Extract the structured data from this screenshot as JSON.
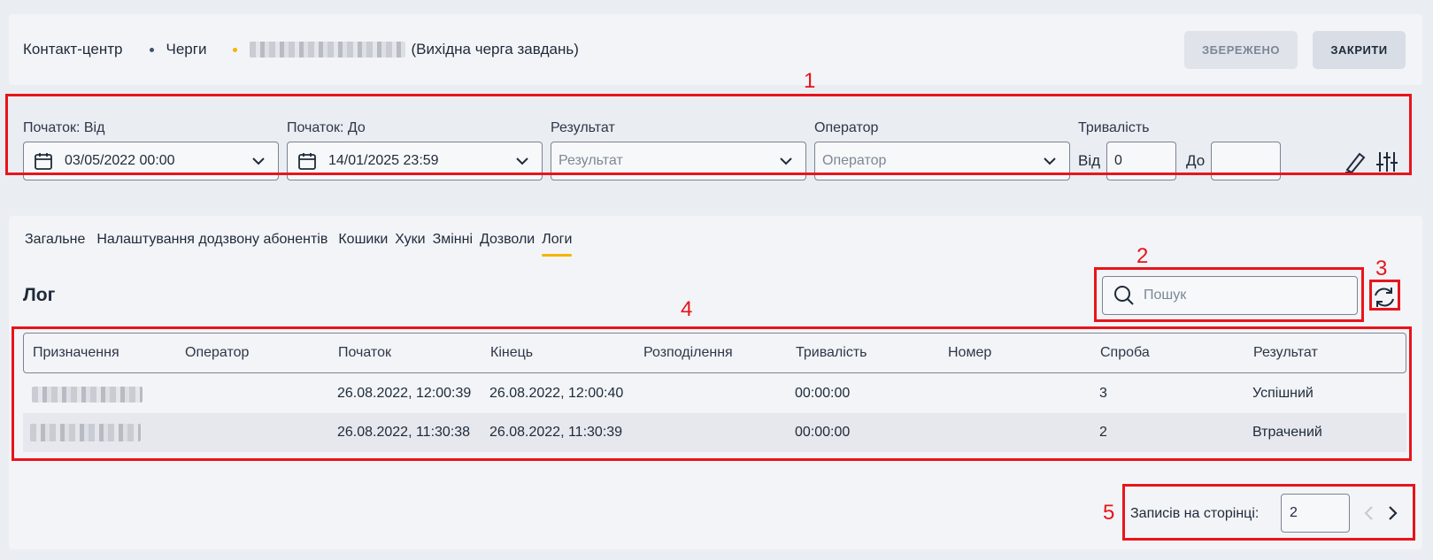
{
  "breadcrumb": {
    "items": [
      "Контакт-центр",
      "Черги"
    ],
    "current_suffix": "(Вихідна черга завдань)"
  },
  "header": {
    "saved_label": "ЗБЕРЕЖЕНО",
    "close_label": "ЗАКРИТИ"
  },
  "filters": {
    "start_from": {
      "label": "Початок: Від",
      "value": "03/05/2022 00:00"
    },
    "start_to": {
      "label": "Початок: До",
      "value": "14/01/2025 23:59"
    },
    "result": {
      "label": "Результат",
      "placeholder": "Результат"
    },
    "operator": {
      "label": "Оператор",
      "placeholder": "Оператор"
    },
    "duration": {
      "label": "Тривалість",
      "from_label": "Від",
      "from_value": "0",
      "to_label": "До",
      "to_value": ""
    }
  },
  "tabs": [
    {
      "label": "Загальне"
    },
    {
      "label": "Налаштування додзвону абонентів"
    },
    {
      "label": "Кошики"
    },
    {
      "label": "Хуки"
    },
    {
      "label": "Змінні"
    },
    {
      "label": "Дозволи"
    },
    {
      "label": "Логи",
      "active": true
    }
  ],
  "log": {
    "title": "Лог",
    "search_placeholder": "Пошук",
    "columns": [
      "Призначення",
      "Оператор",
      "Початок",
      "Кінець",
      "Розподілення",
      "Тривалість",
      "Номер",
      "Спроба",
      "Результат"
    ],
    "rows": [
      {
        "start": "26.08.2022, 12:00:39",
        "end": "26.08.2022, 12:00:40",
        "duration": "00:00:00",
        "attempt": "3",
        "result": "Успішний"
      },
      {
        "start": "26.08.2022, 11:30:38",
        "end": "26.08.2022, 11:30:39",
        "duration": "00:00:00",
        "attempt": "2",
        "result": "Втрачений"
      }
    ]
  },
  "pagination": {
    "label": "Записів на сторінці:",
    "value": "2"
  },
  "annotations": [
    "1",
    "2",
    "3",
    "4",
    "5"
  ],
  "colors": {
    "accent": "#f5b400",
    "annotation": "#e8141b",
    "text": "#1e2a3a"
  }
}
